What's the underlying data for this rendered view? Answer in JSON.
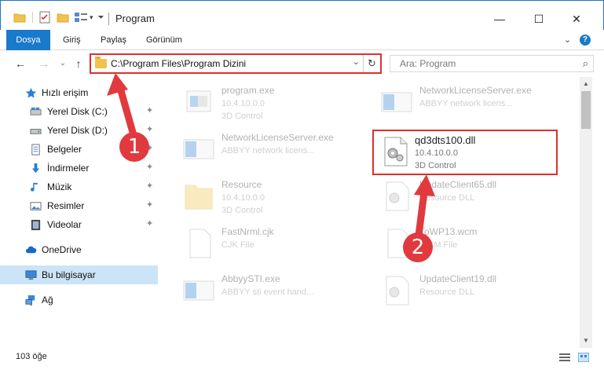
{
  "window": {
    "title": "Program",
    "minimize": "—",
    "maximize": "☐",
    "close": "✕"
  },
  "ribbon": {
    "tabs": [
      "Dosya",
      "Giriş",
      "Paylaş",
      "Görünüm"
    ],
    "expand": "⌄",
    "help": "?"
  },
  "nav": {
    "back": "←",
    "forward": "→",
    "recent": "⌄",
    "up": "↑",
    "address": "C:\\Program Files\\Program Dizini",
    "dropdown": "⌄",
    "refresh": "↻",
    "search_placeholder": "Ara: Program",
    "search_icon": "⌕"
  },
  "sidebar": {
    "quick_access": "Hızlı erişim",
    "pinned": [
      {
        "label": "Yerel Disk (C:)",
        "icon": "drive-icon"
      },
      {
        "label": "Yerel Disk (D:)",
        "icon": "drive-icon"
      },
      {
        "label": "Belgeler",
        "icon": "documents-icon"
      },
      {
        "label": "İndirmeler",
        "icon": "downloads-icon"
      },
      {
        "label": "Müzik",
        "icon": "music-icon"
      },
      {
        "label": "Resimler",
        "icon": "pictures-icon"
      },
      {
        "label": "Videolar",
        "icon": "videos-icon"
      }
    ],
    "onedrive": "OneDrive",
    "this_pc": "Bu bilgisayar",
    "network": "Ağ",
    "pin_glyph": "📌"
  },
  "files": [
    {
      "name": "program.exe",
      "line2": "10.4.10.0.0",
      "line3": "3D Control",
      "type": "exe",
      "faded": true
    },
    {
      "name": "NetworkLicenseServer.exe",
      "line2": "ABBYY network licens...",
      "line3": "",
      "type": "exe",
      "faded": true
    },
    {
      "name": "NetworkLicenseServer.exe",
      "line2": "ABBYY network licens...",
      "line3": "",
      "type": "exe",
      "faded": true
    },
    {
      "name": "qd3dts100.dll",
      "line2": "10.4.10.0.0",
      "line3": "3D Control",
      "type": "dll",
      "faded": false
    },
    {
      "name": "Resource",
      "line2": "10.4.10.0.0",
      "line3": "3D Control",
      "type": "folder",
      "faded": true
    },
    {
      "name": "UpdateClient65.dll",
      "line2": "Resource DLL",
      "line3": "",
      "type": "dll",
      "faded": true
    },
    {
      "name": "FastNrml.cjk",
      "line2": "CJK File",
      "line3": "",
      "type": "blank",
      "faded": true
    },
    {
      "name": "ToWP13.wcm",
      "line2": "WCM File",
      "line3": "",
      "type": "blank",
      "faded": true
    },
    {
      "name": "AbbyySTI.exe",
      "line2": "ABBYY sti event hand...",
      "line3": "",
      "type": "exe",
      "faded": true
    },
    {
      "name": "UpdateClient19.dll",
      "line2": "Resource DLL",
      "line3": "",
      "type": "dll",
      "faded": true
    }
  ],
  "status": {
    "count": "103 öğe"
  },
  "annotations": {
    "step1": "1",
    "step2": "2",
    "color": "#e03a3e"
  },
  "colors": {
    "accent": "#1979ca",
    "highlight": "#e02e2e",
    "selected": "#cce4f7"
  }
}
